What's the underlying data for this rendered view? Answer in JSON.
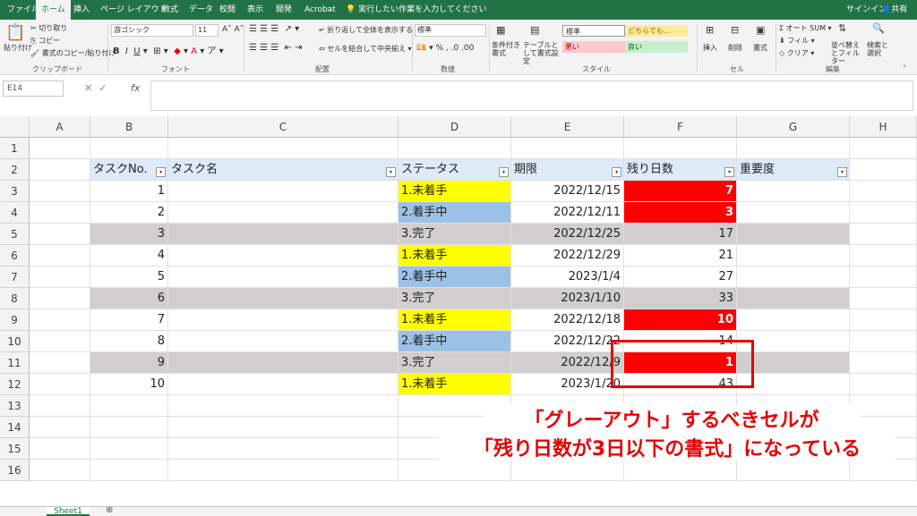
{
  "ribbon_tabs": [
    "ファイル",
    "ホーム",
    "挿入",
    "ページ レイアウト",
    "数式",
    "データ",
    "校閲",
    "表示",
    "開発",
    "Acrobat"
  ],
  "tell_me": "実行したい作業を入力してください",
  "signin": "サインイン",
  "share": "共有",
  "clipboard": {
    "paste": "貼り付け",
    "cut": "切り取り",
    "copy": "コピー",
    "format_painter": "書式のコピー/貼り付け",
    "label": "クリップボード"
  },
  "font": {
    "name": "游ゴシック",
    "size": "11",
    "label": "フォント"
  },
  "alignment": {
    "wrap": "折り返して全体を表示する",
    "merge": "セルを結合して中央揃え",
    "label": "配置"
  },
  "number": {
    "format": "標準",
    "label": "数値"
  },
  "styles": {
    "conditional": "条件付き書式",
    "table": "テーブルとして書式設定",
    "normal": "標準",
    "neutral": "どちらでも...",
    "bad": "悪い",
    "good": "良い",
    "label": "スタイル"
  },
  "cells": {
    "insert": "挿入",
    "delete": "削除",
    "format": "書式",
    "label": "セル"
  },
  "editing": {
    "autosum": "オート SUM",
    "fill": "フィル",
    "clear": "クリア",
    "sort": "並べ替えとフィルター",
    "find": "検索と選択",
    "label": "編集"
  },
  "name_box": "E14",
  "fx": "fx",
  "columns": [
    "A",
    "B",
    "C",
    "D",
    "E",
    "F",
    "G",
    "H"
  ],
  "rows": [
    "1",
    "2",
    "3",
    "4",
    "5",
    "6",
    "7",
    "8",
    "9",
    "10",
    "11",
    "12",
    "13",
    "14",
    "15",
    "16"
  ],
  "headers": {
    "no": "タスクNo.",
    "name": "タスク名",
    "status": "ステータス",
    "due": "期限",
    "remain": "残り日数",
    "priority": "重要度"
  },
  "tasks": [
    {
      "no": "1",
      "status": "1.未着手",
      "due": "2022/12/15",
      "remain": "7"
    },
    {
      "no": "2",
      "status": "2.着手中",
      "due": "2022/12/11",
      "remain": "3"
    },
    {
      "no": "3",
      "status": "3.完了",
      "due": "2022/12/25",
      "remain": "17"
    },
    {
      "no": "4",
      "status": "1.未着手",
      "due": "2022/12/29",
      "remain": "21"
    },
    {
      "no": "5",
      "status": "2.着手中",
      "due": "2023/1/4",
      "remain": "27"
    },
    {
      "no": "6",
      "status": "3.完了",
      "due": "2023/1/10",
      "remain": "33"
    },
    {
      "no": "7",
      "status": "1.未着手",
      "due": "2022/12/18",
      "remain": "10"
    },
    {
      "no": "8",
      "status": "2.着手中",
      "due": "2022/12/22",
      "remain": "14"
    },
    {
      "no": "9",
      "status": "3.完了",
      "due": "2022/12/9",
      "remain": "1"
    },
    {
      "no": "10",
      "status": "1.未着手",
      "due": "2023/1/20",
      "remain": "43"
    }
  ],
  "annotation": {
    "line1": "「グレーアウト」するべきセルが",
    "line2": "「残り日数が3日以下の書式」になっている"
  },
  "sheet_tab": "Sheet1",
  "colors": {
    "excel_green": "#217346",
    "yellow": "#ffff00",
    "blue": "#9bc2e6",
    "gray": "#d0cece",
    "red": "#ff0000",
    "header": "#ddebf7",
    "annotation": "#e60000"
  }
}
